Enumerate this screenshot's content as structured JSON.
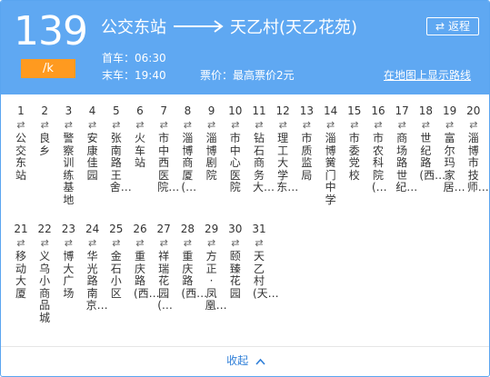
{
  "header": {
    "route_number": "139",
    "fare_badge": "/k",
    "origin": "公交东站",
    "destination": "天乙村(天乙花苑)",
    "return_label": "返程",
    "first_bus": "首车：06:30",
    "last_bus": "末车：19:40",
    "fare_info": "票价：最高票价2元",
    "map_link": "在地图上显示路线"
  },
  "colors": {
    "header_bg": "#5fa8f2",
    "badge_bg": "#ff9a1f",
    "link": "#2f7fd8"
  },
  "stops_row1": [
    {
      "num": "1",
      "dir": "⇄",
      "name": "公交东站"
    },
    {
      "num": "2",
      "dir": "⇄",
      "name": "良乡"
    },
    {
      "num": "3",
      "dir": "⇄",
      "name": "警察训练基地"
    },
    {
      "num": "4",
      "dir": "⇄",
      "name": "安康佳园"
    },
    {
      "num": "5",
      "dir": "⇄",
      "name": "张南路王舍…"
    },
    {
      "num": "6",
      "dir": "⇄",
      "name": "火车站"
    },
    {
      "num": "7",
      "dir": "⇄",
      "name": "市中西医院…"
    },
    {
      "num": "8",
      "dir": "⇄",
      "name": "淄博商厦(…"
    },
    {
      "num": "9",
      "dir": "⇄",
      "name": "淄博剧院"
    },
    {
      "num": "10",
      "dir": "⇄",
      "name": "市中心医院"
    },
    {
      "num": "11",
      "dir": "⇄",
      "name": "钻石商务大…"
    },
    {
      "num": "12",
      "dir": "⇄",
      "name": "理工大学东…"
    },
    {
      "num": "13",
      "dir": "⇄",
      "name": "市质监局"
    },
    {
      "num": "14",
      "dir": "⇄",
      "name": "淄博黉门中学"
    },
    {
      "num": "15",
      "dir": "⇄",
      "name": "市委党校"
    },
    {
      "num": "16",
      "dir": "⇄",
      "name": "市农科院(…"
    },
    {
      "num": "17",
      "dir": "⇄",
      "name": "商场路世纪…"
    },
    {
      "num": "18",
      "dir": "⇄",
      "name": "世纪路(西…"
    },
    {
      "num": "19",
      "dir": "⇄",
      "name": "富尔玛家居…"
    },
    {
      "num": "20",
      "dir": "⇄",
      "name": "淄博市技师…"
    }
  ],
  "stops_row2": [
    {
      "num": "21",
      "dir": "⇄",
      "name": "移动大厦"
    },
    {
      "num": "22",
      "dir": "⇄",
      "name": "义乌小商品城"
    },
    {
      "num": "23",
      "dir": "⇄",
      "name": "博大广场"
    },
    {
      "num": "24",
      "dir": "⇄",
      "name": "华光路南京…"
    },
    {
      "num": "25",
      "dir": "⇄",
      "name": "金石小区"
    },
    {
      "num": "26",
      "dir": "⇄",
      "name": "重庆路(西…"
    },
    {
      "num": "27",
      "dir": "⇄",
      "name": "祥瑞花园(…"
    },
    {
      "num": "28",
      "dir": "⇄",
      "name": "重庆路(西…"
    },
    {
      "num": "29",
      "dir": "⇄",
      "name": "方正·凤凰…"
    },
    {
      "num": "30",
      "dir": "⇄",
      "name": "颐臻花园"
    },
    {
      "num": "31",
      "dir": "⇄",
      "name": "天乙村(天…"
    }
  ],
  "collapse_label": "收起",
  "icons": {
    "direction_arrow": "long-right-arrow-icon",
    "swap": "swap-arrows-icon",
    "collapse": "chevron-up-icon"
  }
}
